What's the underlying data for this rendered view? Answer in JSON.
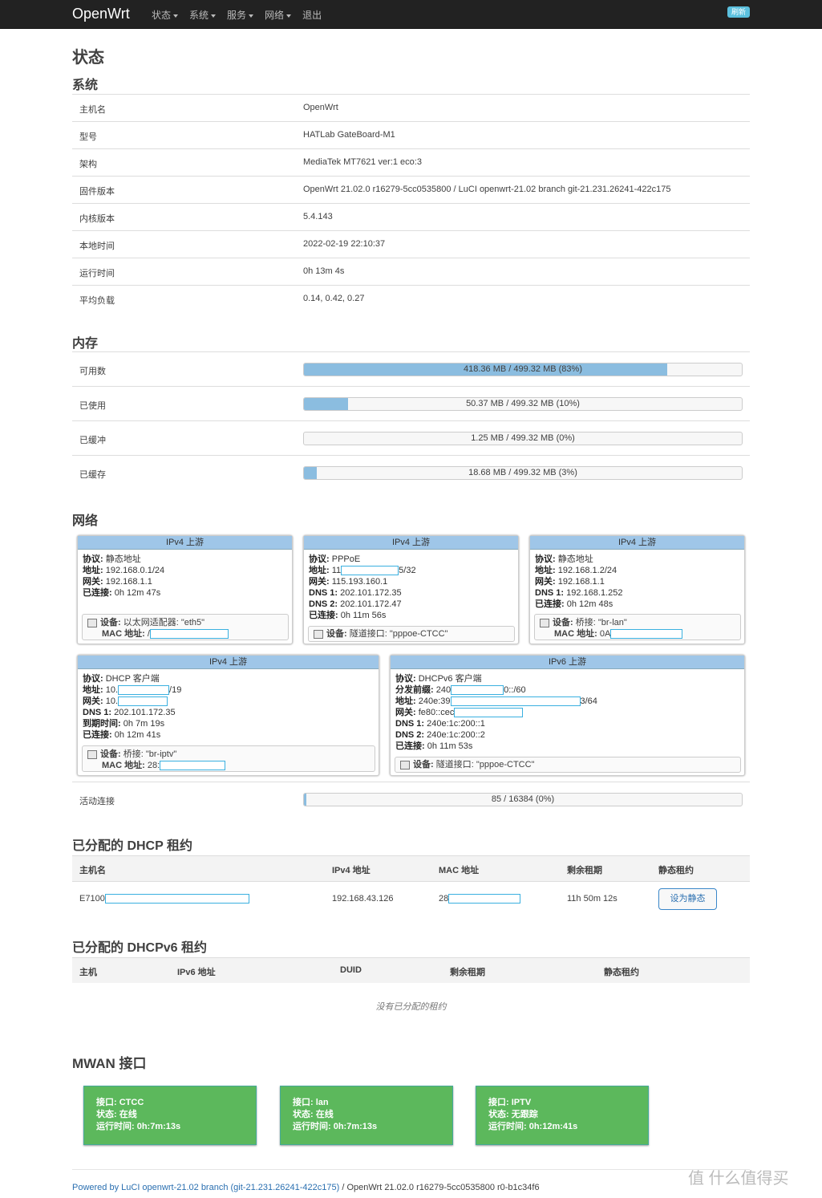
{
  "nav": {
    "brand": "OpenWrt",
    "menu": [
      "状态",
      "系统",
      "服务",
      "网络",
      "退出"
    ],
    "refresh": "刷新"
  },
  "page_title": "状态",
  "system": {
    "title": "系统",
    "rows": [
      {
        "k": "主机名",
        "v": "OpenWrt"
      },
      {
        "k": "型号",
        "v": "HATLab GateBoard-M1"
      },
      {
        "k": "架构",
        "v": "MediaTek MT7621 ver:1 eco:3"
      },
      {
        "k": "固件版本",
        "v": "OpenWrt 21.02.0 r16279-5cc0535800 / LuCI openwrt-21.02 branch git-21.231.26241-422c175"
      },
      {
        "k": "内核版本",
        "v": "5.4.143"
      },
      {
        "k": "本地时间",
        "v": "2022-02-19 22:10:37"
      },
      {
        "k": "运行时间",
        "v": "0h 13m 4s"
      },
      {
        "k": "平均负载",
        "v": "0.14, 0.42, 0.27"
      }
    ]
  },
  "memory": {
    "title": "内存",
    "rows": [
      {
        "k": "可用数",
        "text": "418.36 MB / 499.32 MB (83%)",
        "fraction": 0.83
      },
      {
        "k": "已使用",
        "text": "50.37 MB / 499.32 MB (10%)",
        "fraction": 0.1
      },
      {
        "k": "已缓冲",
        "text": "1.25 MB / 499.32 MB (0%)",
        "fraction": 0.0
      },
      {
        "k": "已缓存",
        "text": "18.68 MB / 499.32 MB (3%)",
        "fraction": 0.03
      }
    ]
  },
  "network": {
    "title": "网络",
    "box1": {
      "header": "IPv4 上游",
      "l1k": "协议:",
      "l1v": "静态地址",
      "l2k": "地址:",
      "l2v": "192.168.0.1/24",
      "l3k": "网关:",
      "l3v": "192.168.1.1",
      "l4k": "已连接:",
      "l4v": "0h 12m 47s",
      "dev_k": "设备:",
      "dev_v": "以太网适配器: \"eth5\"",
      "mac_k": "MAC 地址:",
      "mac_v": "/"
    },
    "box2": {
      "header": "IPv4 上游",
      "l1k": "协议:",
      "l1v": "PPPoE",
      "l2k": "地址:",
      "l2v": "11",
      "l2v_tail": "5/32",
      "l3k": "网关:",
      "l3v": "115.193.160.1",
      "l4k": "DNS 1:",
      "l4v": "202.101.172.35",
      "l5k": "DNS 2:",
      "l5v": "202.101.172.47",
      "l6k": "已连接:",
      "l6v": "0h 11m 56s",
      "dev_k": "设备:",
      "dev_v": "隧道接口: \"pppoe-CTCC\""
    },
    "box3": {
      "header": "IPv4 上游",
      "l1k": "协议:",
      "l1v": "静态地址",
      "l2k": "地址:",
      "l2v": "192.168.1.2/24",
      "l3k": "网关:",
      "l3v": "192.168.1.1",
      "l4k": "DNS 1:",
      "l4v": "192.168.1.252",
      "l5k": "已连接:",
      "l5v": "0h 12m 48s",
      "dev_k": "设备:",
      "dev_v": "桥接: \"br-lan\"",
      "mac_k": "MAC 地址:",
      "mac_v": "0A"
    },
    "box4": {
      "header": "IPv4 上游",
      "l1k": "协议:",
      "l1v": "DHCP 客户端",
      "l2k": "地址:",
      "l2v": "10.",
      "l2v_tail": "/19",
      "l3k": "网关:",
      "l3v": "10.",
      "l4k": "DNS 1:",
      "l4v": "202.101.172.35",
      "l5k": "到期时间:",
      "l5v": "0h 7m 19s",
      "l6k": "已连接:",
      "l6v": "0h 12m 41s",
      "dev_k": "设备:",
      "dev_v": "桥接: \"br-iptv\"",
      "mac_k": "MAC 地址:",
      "mac_v": "28:"
    },
    "box5": {
      "header": "IPv6 上游",
      "l1k": "协议:",
      "l1v": "DHCPv6 客户端",
      "l2k": "分发前缀:",
      "l2v": "240",
      "l2v_tail": "0::/60",
      "l3k": "地址:",
      "l3v": "240e:39",
      "l3v_tail": "3/64",
      "l4k": "网关:",
      "l4v": "fe80::cec",
      "l5k": "DNS 1:",
      "l5v": "240e:1c:200::1",
      "l6k": "DNS 2:",
      "l6v": "240e:1c:200::2",
      "l7k": "已连接:",
      "l7v": "0h 11m 53s",
      "dev_k": "设备:",
      "dev_v": "隧道接口: \"pppoe-CTCC\""
    },
    "active": {
      "k": "活动连接",
      "text": "85 / 16384 (0%)",
      "fraction": 0.005
    }
  },
  "dhcp": {
    "title": "已分配的 DHCP 租约",
    "headers": [
      "主机名",
      "IPv4 地址",
      "MAC 地址",
      "剩余租期",
      "静态租约"
    ],
    "row": {
      "host": "E7100",
      "ip": "192.168.43.126",
      "mac": "28",
      "lease": "11h 50m 12s",
      "button": "设为静态"
    }
  },
  "dhcp6": {
    "title": "已分配的 DHCPv6 租约",
    "headers": [
      "主机",
      "IPv6 地址",
      "DUID",
      "剩余租期",
      "静态租约"
    ],
    "empty": "没有已分配的租约"
  },
  "mwan": {
    "title": "MWAN 接口",
    "cards": [
      {
        "l1": "接口: CTCC",
        "l2": "状态: 在线",
        "l3": "运行时间: 0h:7m:13s"
      },
      {
        "l1": "接口: lan",
        "l2": "状态: 在线",
        "l3": "运行时间: 0h:7m:13s"
      },
      {
        "l1": "接口: IPTV",
        "l2": "状态: 无跟踪",
        "l3": "运行时间: 0h:12m:41s"
      }
    ]
  },
  "footer": {
    "link": "Powered by LuCI openwrt-21.02 branch (git-21.231.26241-422c175)",
    "rest": " / OpenWrt 21.02.0 r16279-5cc0535800 r0-b1c34f6"
  },
  "watermark": "值 什么值得买"
}
